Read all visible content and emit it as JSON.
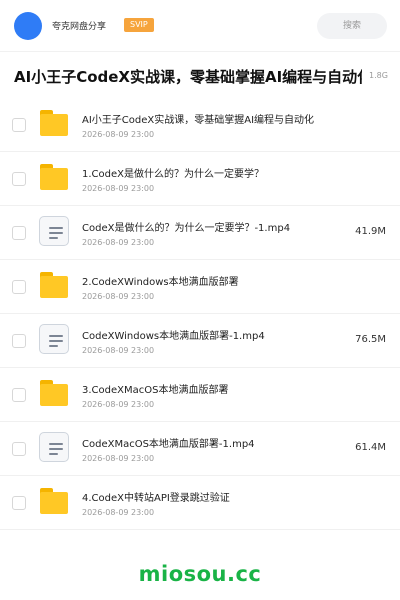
{
  "header": {
    "username": "夸克网盘分享",
    "badge": "SVIP",
    "search_label": "搜索"
  },
  "folder": {
    "title": "AI小王子CodeX实战课，零基础掌握AI编程与自动化",
    "size": "1.8G"
  },
  "items": [
    {
      "type": "folder",
      "name": "AI小王子CodeX实战课，零基础掌握AI编程与自动化",
      "date": "2026-08-09 23:00",
      "size": ""
    },
    {
      "type": "folder",
      "name": "1.CodeX是做什么的？为什么一定要学？",
      "date": "2026-08-09 23:00",
      "size": ""
    },
    {
      "type": "file",
      "name": "CodeX是做什么的？为什么一定要学？-1.mp4",
      "date": "2026-08-09 23:00",
      "size": "41.9M"
    },
    {
      "type": "folder",
      "name": "2.CodeXWindows本地满血版部署",
      "date": "2026-08-09 23:00",
      "size": ""
    },
    {
      "type": "file",
      "name": "CodeXWindows本地满血版部署-1.mp4",
      "date": "2026-08-09 23:00",
      "size": "76.5M"
    },
    {
      "type": "folder",
      "name": "3.CodeXMacOS本地满血版部署",
      "date": "2026-08-09 23:00",
      "size": ""
    },
    {
      "type": "file",
      "name": "CodeXMacOS本地满血版部署-1.mp4",
      "date": "2026-08-09 23:00",
      "size": "61.4M"
    },
    {
      "type": "folder",
      "name": "4.CodeX中转站API登录跳过验证",
      "date": "2026-08-09 23:00",
      "size": ""
    }
  ],
  "watermark": "miosou.cc",
  "colors": {
    "avatar": "#2f7cf6",
    "badge": "#f6a43c",
    "folder": "#ffc825",
    "watermark": "#19b346"
  }
}
